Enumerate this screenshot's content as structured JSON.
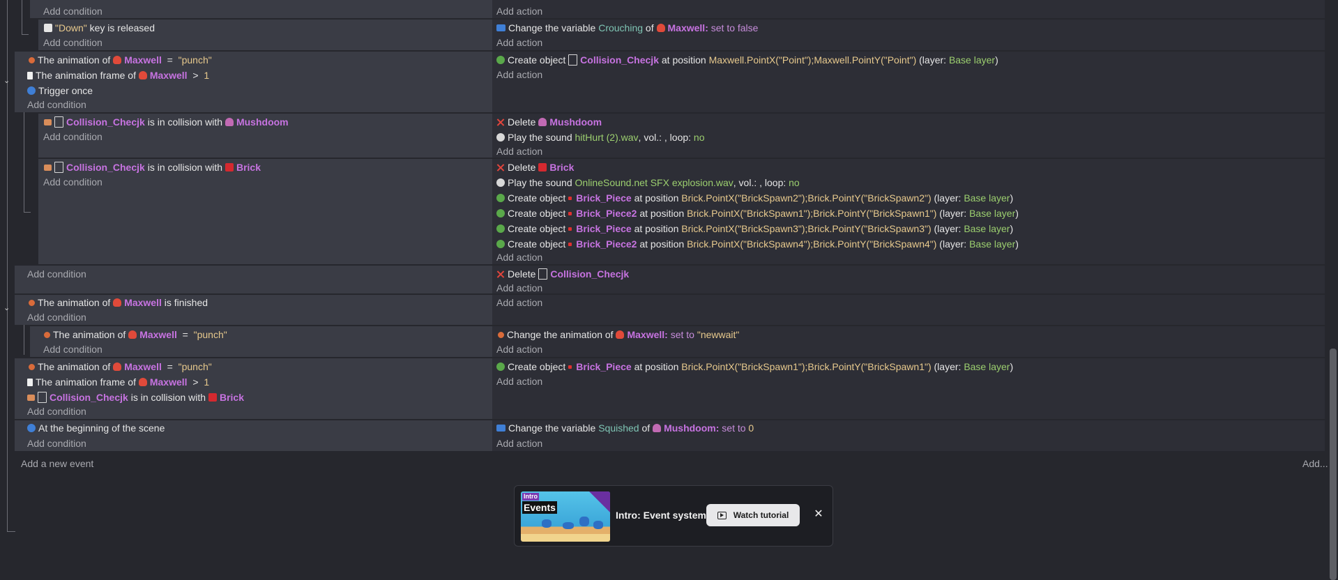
{
  "events": {
    "e0": {
      "add_condition": "Add condition",
      "add_action": "Add action"
    },
    "e1": {
      "cond_key": "\"Down\"",
      "cond_text": "key is released",
      "add_condition": "Add condition",
      "act_prefix": "Change the variable",
      "act_var": "Crouching",
      "act_of": "of",
      "act_obj": "Maxwell:",
      "act_set": "set to false",
      "add_action": "Add action"
    },
    "e2": {
      "c1_prefix": "The animation of",
      "c1_obj": "Maxwell",
      "c1_op": "=",
      "c1_val": "\"punch\"",
      "c2_prefix": "The animation frame of",
      "c2_obj": "Maxwell",
      "c2_op": ">",
      "c2_val": "1",
      "c3_text": "Trigger once",
      "add_condition": "Add condition",
      "a1_prefix": "Create object",
      "a1_obj": "Collision_Checjk",
      "a1_at": "at position",
      "a1_pos": "Maxwell.PointX(\"Point\");Maxwell.PointY(\"Point\")",
      "a1_layer_pre": "(layer:",
      "a1_layer": "Base layer",
      "a1_close": ")",
      "add_action": "Add action"
    },
    "e3": {
      "c_obj": "Collision_Checjk",
      "c_mid": "is in collision with",
      "c_target": "Mushdoom",
      "add_condition": "Add condition",
      "a1_prefix": "Delete",
      "a1_obj": "Mushdoom",
      "a2_prefix": "Play the sound",
      "a2_file": "hitHurt (2).wav",
      "a2_rest": ", vol.: , loop:",
      "a2_loop": "no",
      "add_action": "Add action"
    },
    "e4": {
      "c_obj": "Collision_Checjk",
      "c_mid": "is in collision with",
      "c_target": "Brick",
      "add_condition": "Add condition",
      "a1_prefix": "Delete",
      "a1_obj": "Brick",
      "a2_prefix": "Play the sound",
      "a2_file": "OnlineSound.net SFX explosion.wav",
      "a2_rest": ", vol.: , loop:",
      "a2_loop": "no",
      "creates": [
        {
          "prefix": "Create object",
          "obj": "Brick_Piece",
          "at": "at position",
          "pos": "Brick.PointX(\"BrickSpawn2\");Brick.PointY(\"BrickSpawn2\")",
          "layer_pre": "(layer:",
          "layer": "Base layer",
          "close": ")"
        },
        {
          "prefix": "Create object",
          "obj": "Brick_Piece2",
          "at": "at position",
          "pos": "Brick.PointX(\"BrickSpawn1\");Brick.PointY(\"BrickSpawn1\")",
          "layer_pre": "(layer:",
          "layer": "Base layer",
          "close": ")"
        },
        {
          "prefix": "Create object",
          "obj": "Brick_Piece",
          "at": "at position",
          "pos": "Brick.PointX(\"BrickSpawn3\");Brick.PointY(\"BrickSpawn3\")",
          "layer_pre": "(layer:",
          "layer": "Base layer",
          "close": ")"
        },
        {
          "prefix": "Create object",
          "obj": "Brick_Piece2",
          "at": "at position",
          "pos": "Brick.PointX(\"BrickSpawn4\");Brick.PointY(\"BrickSpawn4\")",
          "layer_pre": "(layer:",
          "layer": "Base layer",
          "close": ")"
        }
      ],
      "add_action": "Add action"
    },
    "e5": {
      "add_condition": "Add condition",
      "a1_prefix": "Delete",
      "a1_obj": "Collision_Checjk",
      "add_action": "Add action"
    },
    "e6": {
      "c_prefix": "The animation of",
      "c_obj": "Maxwell",
      "c_suffix": "is finished",
      "add_condition": "Add condition",
      "add_action": "Add action"
    },
    "e7": {
      "c_prefix": "The animation of",
      "c_obj": "Maxwell",
      "c_op": "=",
      "c_val": "\"punch\"",
      "add_condition": "Add condition",
      "a1_prefix": "Change the animation of",
      "a1_obj": "Maxwell:",
      "a1_set": "set to",
      "a1_val": "\"newwait\"",
      "add_action": "Add action"
    },
    "e8": {
      "c1_prefix": "The animation of",
      "c1_obj": "Maxwell",
      "c1_op": "=",
      "c1_val": "\"punch\"",
      "c2_prefix": "The animation frame of",
      "c2_obj": "Maxwell",
      "c2_op": ">",
      "c2_val": "1",
      "c3_obj": "Collision_Checjk",
      "c3_mid": "is in collision with",
      "c3_target": "Brick",
      "add_condition": "Add condition",
      "a1_prefix": "Create object",
      "a1_obj": "Brick_Piece",
      "a1_at": "at position",
      "a1_pos": "Brick.PointX(\"BrickSpawn1\");Brick.PointY(\"BrickSpawn1\")",
      "a1_layer_pre": "(layer:",
      "a1_layer": "Base layer",
      "a1_close": ")",
      "add_action": "Add action"
    },
    "e9": {
      "c_text": "At the beginning of the scene",
      "add_condition": "Add condition",
      "a1_prefix": "Change the variable",
      "a1_var": "Squished",
      "a1_of": "of",
      "a1_obj": "Mushdoom:",
      "a1_set": "set to",
      "a1_val": "0",
      "add_action": "Add action"
    }
  },
  "footer": {
    "add_event": "Add a new event",
    "add_more": "Add..."
  },
  "tutorial": {
    "thumb_tag": "Intro",
    "thumb_title": "Events",
    "title": "Intro: Event system",
    "watch": "Watch tutorial",
    "close": "✕"
  }
}
